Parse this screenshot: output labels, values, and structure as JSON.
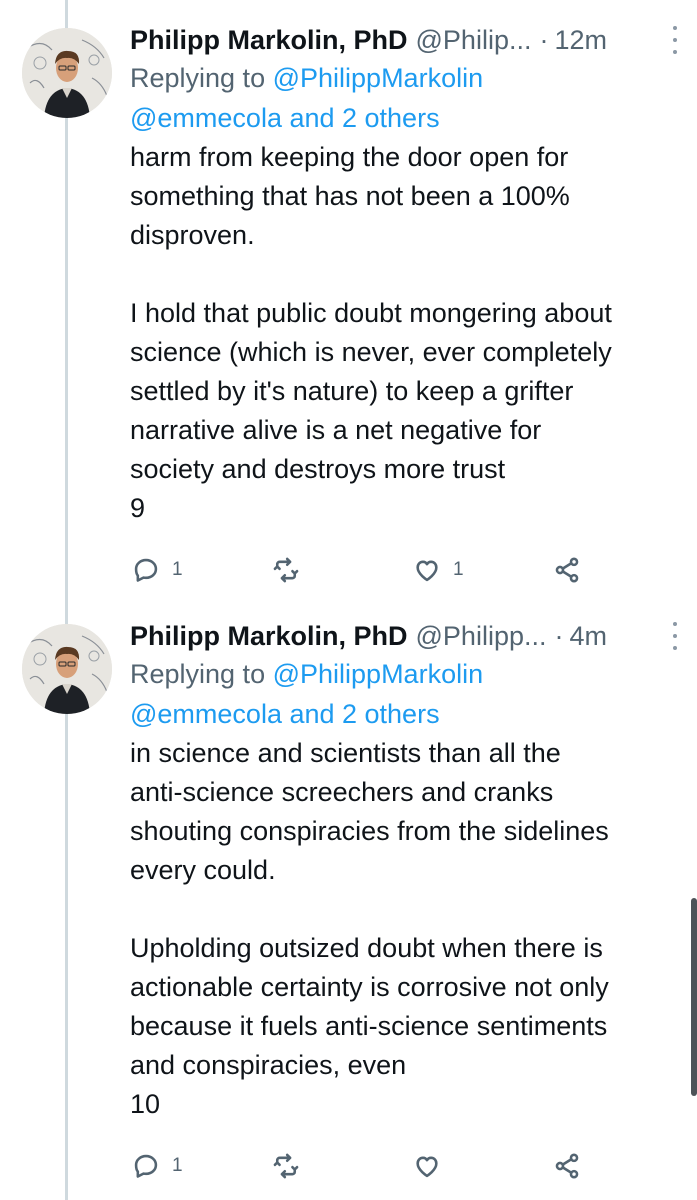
{
  "tweets": [
    {
      "author_name": "Philipp Markolin, PhD",
      "author_handle": "@Philip...",
      "dot": "·",
      "time": "12m",
      "replying_prefix": "Replying to",
      "replying_handle": "@PhilippMarkolin",
      "replying_others": "@emmecola and 2 others",
      "paragraph1": [
        "harm from keeping the door open for",
        "something that has not been a 100%",
        "disproven."
      ],
      "paragraph2": [
        "I hold that public doubt mongering about",
        "science (which is never, ever completely",
        "settled by it's nature) to keep a grifter",
        "narrative alive is a net negative for",
        "society and destroys more trust",
        "9"
      ],
      "reply_count": "1",
      "retweet_count": "",
      "like_count": "1"
    },
    {
      "author_name": "Philipp Markolin, PhD",
      "author_handle": "@Philipp...",
      "dot": "·",
      "time": "4m",
      "replying_prefix": "Replying to",
      "replying_handle": "@PhilippMarkolin",
      "replying_others": "@emmecola and 2 others",
      "paragraph1": [
        "in science and scientists than all the",
        "anti-science screechers and cranks",
        "shouting conspiracies from the sidelines",
        "every could."
      ],
      "paragraph2": [
        "Upholding outsized doubt when there is",
        "actionable certainty is corrosive not only",
        "because it fuels anti-science sentiments",
        "and conspiracies, even",
        "10"
      ],
      "reply_count": "1",
      "retweet_count": "",
      "like_count": ""
    }
  ],
  "icons": {
    "reply": "reply-icon",
    "retweet": "retweet-icon",
    "like": "like-icon",
    "share": "share-icon",
    "more": "more-options-icon"
  },
  "colors": {
    "link": "#1d9bf0",
    "secondary_text": "#536471",
    "primary_text": "#0f1419",
    "thread_line": "#cfd9de"
  }
}
